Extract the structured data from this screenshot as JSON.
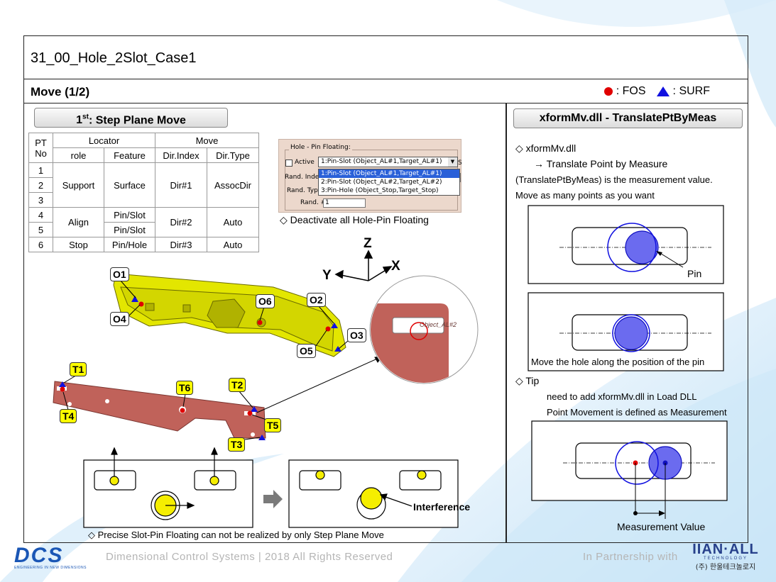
{
  "slide": {
    "title": "31_00_Hole_2Slot_Case1",
    "subtitle": "Move (1/2)",
    "legend": {
      "fos_label": ": FOS",
      "surf_label": ": SURF",
      "fos_color": "#e00000",
      "surf_color": "#1010e0"
    }
  },
  "left": {
    "step_sup": "1st",
    "step_title": ": Step Plane Move",
    "table": {
      "header_pt": [
        "PT",
        "No"
      ],
      "header_locator": "Locator",
      "header_move": "Move",
      "sub_headers": [
        "role",
        "Feature",
        "Dir.Index",
        "Dir.Type"
      ],
      "pt_numbers": [
        "1",
        "2",
        "3",
        "4",
        "5",
        "6"
      ],
      "groups": [
        {
          "role": "Support",
          "features": [
            "Surface"
          ],
          "dir_index": "Dir#1",
          "dir_type": "AssocDir"
        },
        {
          "role": "Align",
          "features": [
            "Pin/Slot",
            "Pin/Slot"
          ],
          "dir_index": "Dir#2",
          "dir_type": "Auto"
        },
        {
          "role": "Stop",
          "features": [
            "Pin/Hole"
          ],
          "dir_index": "Dir#3",
          "dir_type": "Auto"
        }
      ]
    },
    "floating_panel": {
      "group_title": "Hole - Pin Floating:",
      "active_label": "Active",
      "selected": "1:Pin-Slot (Object_AL#1,Target_AL#1)",
      "options": [
        "1:Pin-Slot (Object_AL#1,Target_AL#1)",
        "2:Pin-Slot (Object_AL#2,Target_AL#2)",
        "3:Pin-Hole (Object_Stop,Target_Stop)"
      ],
      "rand_labels": [
        "Rand. Inde",
        "Rand. Typ",
        "Rand. #"
      ],
      "rand_value": "1",
      "side_char": "S"
    },
    "deactivate_note": "◇ Deactivate all Hole-Pin Floating",
    "axes": {
      "z": "Z",
      "y": "Y",
      "x": "X"
    },
    "object_callouts": [
      "O1",
      "O4",
      "O6",
      "O2",
      "O5",
      "O3"
    ],
    "target_callouts": [
      "T1",
      "T4",
      "T6",
      "T2",
      "T5",
      "T3"
    ],
    "zoom_label": "Object_AL#2",
    "interference_label": "Interference",
    "bottom_note": "◇ Precise Slot-Pin Floating can not be realized by only Step Plane Move"
  },
  "right": {
    "title": "xformMv.dll - TranslatePtByMeas",
    "lines": [
      "◇ xformMv.dll",
      "→ Translate Point by Measure",
      "(TranslatePtByMeas) is the measurement value.",
      "Move as many points as you want"
    ],
    "pin_label": "Pin",
    "move_hole_caption": "Move the hole along the position of the pin",
    "tip_title": "◇ Tip",
    "tip_lines": [
      "need to add xformMv.dll in Load DLL",
      "Point Movement is defined as Measurement"
    ],
    "measurement_label": "Measurement Value"
  },
  "footer": {
    "logo_text": "DCS",
    "logo_tagline": "ENGINEERING IN NEW DIMENSIONS",
    "copyright": "Dimensional Control Systems | 2018 All Rights Reserved",
    "partnership": "In Partnership with",
    "partner_logo": "IIAN·ALL",
    "partner_tech": "TECHNOLOGY",
    "partner_korean": "(주) 한울테크놀로지"
  }
}
